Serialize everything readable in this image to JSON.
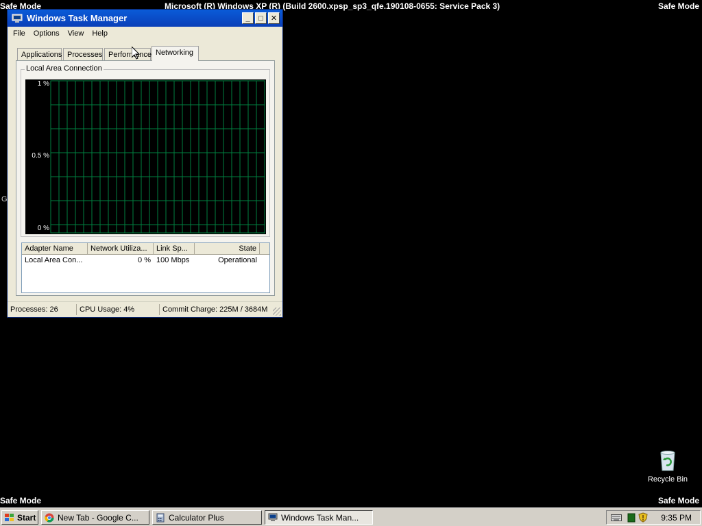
{
  "desktop": {
    "safe_mode_label": "Safe Mode",
    "build_text": "Microsoft (R) Windows XP (R) (Build 2600.xpsp_sp3_qfe.190108-0655: Service Pack 3)",
    "stray_text": "G",
    "recycle_bin_label": "Recycle Bin"
  },
  "window": {
    "title": "Windows Task Manager",
    "menu": [
      "File",
      "Options",
      "View",
      "Help"
    ],
    "tabs": [
      "Applications",
      "Processes",
      "Performance",
      "Networking"
    ],
    "active_tab": "Networking",
    "group_title": "Local Area Connection",
    "graph": {
      "y_labels": [
        "1 %",
        "0.5 %",
        "0 %"
      ],
      "grid_color": "#008040"
    },
    "adapters": {
      "columns": [
        "Adapter Name",
        "Network Utiliza...",
        "Link Sp...",
        "State"
      ],
      "rows": [
        {
          "name": "Local Area Con...",
          "utilization": "0 %",
          "link_speed": "100 Mbps",
          "state": "Operational"
        }
      ]
    },
    "status": {
      "processes": "Processes: 26",
      "cpu": "CPU Usage: 4%",
      "commit": "Commit Charge: 225M / 3684M"
    }
  },
  "taskbar": {
    "start_label": "Start",
    "tasks": [
      {
        "label": "New Tab - Google C...",
        "icon": "chrome-icon"
      },
      {
        "label": "Calculator Plus",
        "icon": "calculator-icon"
      },
      {
        "label": "Windows Task Man...",
        "icon": "task-manager-icon"
      }
    ],
    "clock": "9:35 PM"
  }
}
